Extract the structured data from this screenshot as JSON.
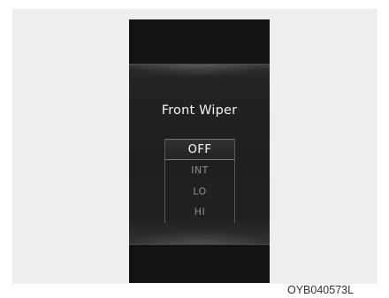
{
  "display": {
    "title": "Front Wiper",
    "options": [
      {
        "label": "OFF",
        "selected": true
      },
      {
        "label": "INT",
        "selected": false
      },
      {
        "label": "LO",
        "selected": false
      },
      {
        "label": "HI",
        "selected": false
      }
    ]
  },
  "figure_code": "OYB040573L",
  "colors": {
    "panel_background": "#141414",
    "selected_text": "#ffffff",
    "unselected_text": "#8f8f8f"
  }
}
